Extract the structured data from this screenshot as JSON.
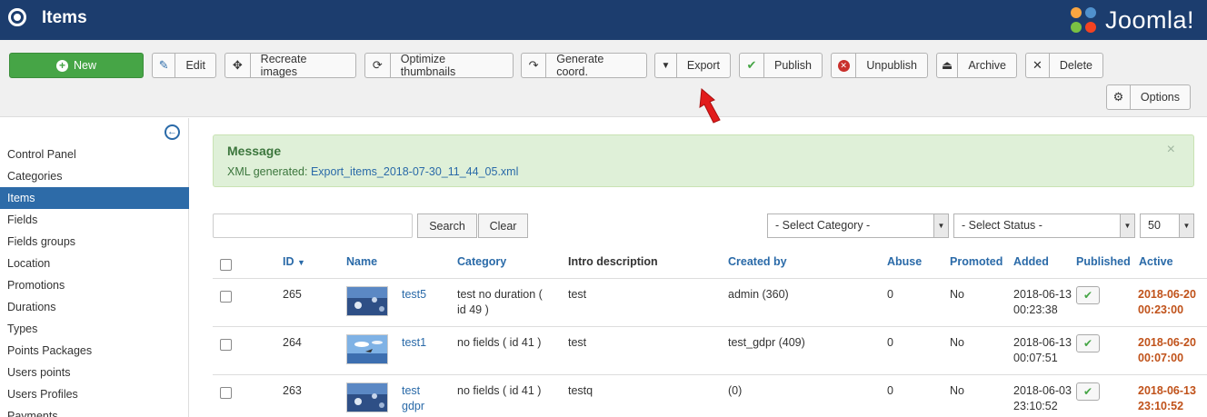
{
  "header": {
    "title": "Items",
    "brand": "Joomla!"
  },
  "toolbar": {
    "new": "New",
    "edit": "Edit",
    "recreate": "Recreate images",
    "optimize": "Optimize thumbnails",
    "generate": "Generate coord.",
    "export": "Export",
    "publish": "Publish",
    "unpublish": "Unpublish",
    "archive": "Archive",
    "delete": "Delete",
    "options": "Options"
  },
  "sidebar": {
    "items": [
      "Control Panel",
      "Categories",
      "Items",
      "Fields",
      "Fields groups",
      "Location",
      "Promotions",
      "Durations",
      "Types",
      "Points Packages",
      "Users points",
      "Users Profiles",
      "Payments"
    ],
    "active_index": 2
  },
  "message": {
    "title": "Message",
    "prefix": "XML generated:",
    "file": "Export_items_2018-07-30_11_44_05.xml",
    "close": "×"
  },
  "filters": {
    "search_value": "",
    "search_button": "Search",
    "clear_button": "Clear",
    "category": "- Select Category -",
    "status": "- Select Status -",
    "limit": "50"
  },
  "table": {
    "headers": {
      "id": "ID",
      "name": "Name",
      "category": "Category",
      "intro": "Intro description",
      "created_by": "Created by",
      "abuse": "Abuse",
      "promoted": "Promoted",
      "added": "Added",
      "published": "Published",
      "active": "Active"
    },
    "rows": [
      {
        "id": "265",
        "name_1": "test5",
        "name_2": "",
        "cat_1": "test no duration (",
        "cat_2": "id 49 )",
        "intro": "test",
        "created_by": "admin (360)",
        "abuse": "0",
        "promoted": "No",
        "added_date": "2018-06-13",
        "added_time": "00:23:38",
        "active_date": "2018-06-20",
        "active_time": "00:23:00"
      },
      {
        "id": "264",
        "name_1": "test1",
        "name_2": "",
        "cat_1": "no fields ( id 41 )",
        "cat_2": "",
        "intro": "test",
        "created_by": "test_gdpr (409)",
        "abuse": "0",
        "promoted": "No",
        "added_date": "2018-06-13",
        "added_time": "00:07:51",
        "active_date": "2018-06-20",
        "active_time": "00:07:00"
      },
      {
        "id": "263",
        "name_1": "test",
        "name_2": "gdpr",
        "cat_1": "no fields ( id 41 )",
        "cat_2": "",
        "intro": "testq",
        "created_by": "(0)",
        "abuse": "0",
        "promoted": "No",
        "added_date": "2018-06-03",
        "added_time": "23:10:52",
        "active_date": "2018-06-13",
        "active_time": "23:10:52"
      }
    ]
  },
  "colors": {
    "header_bg": "#1c3d6e",
    "accent": "#2a6aa8",
    "success": "#46a546",
    "danger": "#c0521a"
  }
}
